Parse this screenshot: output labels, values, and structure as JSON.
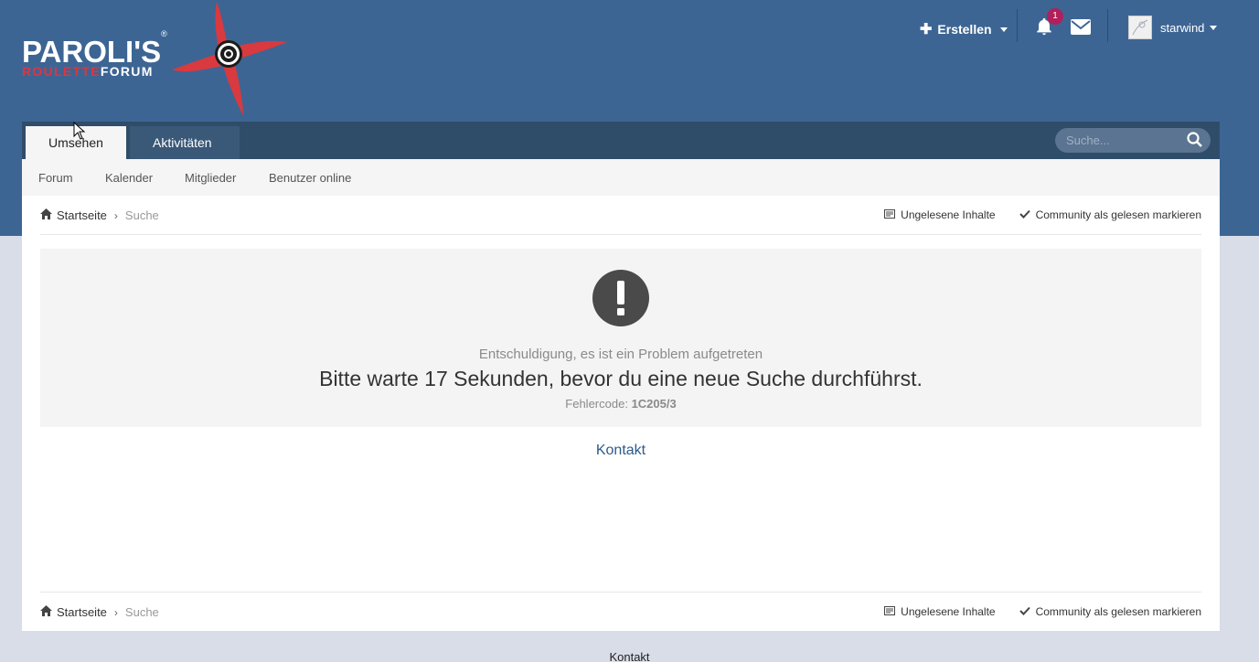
{
  "logo": {
    "line1": "PAROLI'S",
    "reg": "®",
    "line2_red": "ROULETTE",
    "line2_white": "FORUM"
  },
  "user_bar": {
    "create_label": "Erstellen",
    "notification_count": "1",
    "username": "starwind"
  },
  "nav": {
    "tabs": [
      {
        "label": "Umsehen",
        "active": true
      },
      {
        "label": "Aktivitäten",
        "active": false
      }
    ],
    "search_placeholder": "Suche..."
  },
  "subnav": {
    "items": [
      "Forum",
      "Kalender",
      "Mitglieder",
      "Benutzer online"
    ]
  },
  "breadcrumb": {
    "home": "Startseite",
    "current": "Suche",
    "unread_label": "Ungelesene Inhalte",
    "mark_read_label": "Community als gelesen markieren"
  },
  "error": {
    "subtitle": "Entschuldigung, es ist ein Problem aufgetreten",
    "message": "Bitte warte 17 Sekunden, bevor du eine neue Suche durchführst.",
    "code_label": "Fehlercode:",
    "code": "1C205/3"
  },
  "contact_label": "Kontakt",
  "footer": {
    "contact_label": "Kontakt"
  },
  "colors": {
    "header_bg": "#3d6594",
    "nav_bg": "#2f4d69",
    "accent_red": "#e0343d",
    "badge": "#b0205a",
    "link": "#2c5a8c"
  }
}
